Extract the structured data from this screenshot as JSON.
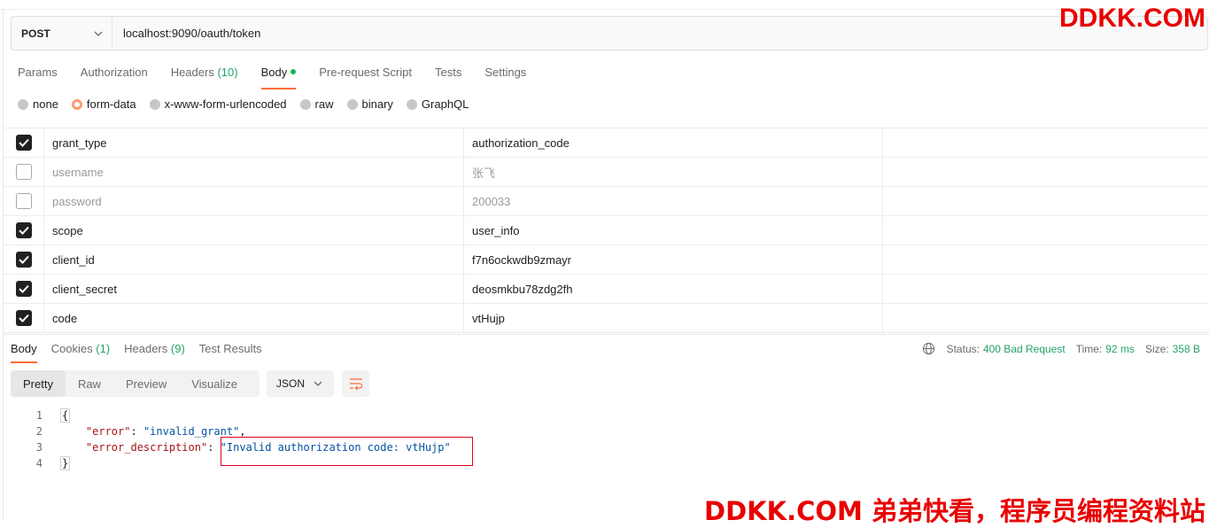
{
  "request": {
    "method": "POST",
    "url": "localhost:9090/oauth/token"
  },
  "request_tabs": {
    "params": "Params",
    "authorization": "Authorization",
    "headers": "Headers",
    "headers_count": "(10)",
    "body": "Body",
    "pre_request": "Pre-request Script",
    "tests": "Tests",
    "settings": "Settings",
    "active": "Body"
  },
  "body_types": {
    "none": "none",
    "form_data": "form-data",
    "urlencoded": "x-www-form-urlencoded",
    "raw": "raw",
    "binary": "binary",
    "graphql": "GraphQL",
    "selected": "form-data"
  },
  "params": [
    {
      "checked": true,
      "key": "grant_type",
      "value": "authorization_code"
    },
    {
      "checked": false,
      "key": "username",
      "value": "张飞"
    },
    {
      "checked": false,
      "key": "password",
      "value": "200033"
    },
    {
      "checked": true,
      "key": "scope",
      "value": "user_info"
    },
    {
      "checked": true,
      "key": "client_id",
      "value": "f7n6ockwdb9zmayr"
    },
    {
      "checked": true,
      "key": "client_secret",
      "value": "deosmkbu78zdg2fh"
    },
    {
      "checked": true,
      "key": "code",
      "value": "vtHujp"
    }
  ],
  "response_tabs": {
    "body": "Body",
    "cookies": "Cookies",
    "cookies_count": "(1)",
    "headers": "Headers",
    "headers_count": "(9)",
    "test_results": "Test Results"
  },
  "status": {
    "status_label": "Status:",
    "status_value": "400 Bad Request",
    "time_label": "Time:",
    "time_value": "92 ms",
    "size_label": "Size:",
    "size_value": "358 B"
  },
  "view": {
    "pretty": "Pretty",
    "raw": "Raw",
    "preview": "Preview",
    "visualize": "Visualize",
    "format": "JSON"
  },
  "code": {
    "line_numbers": [
      "1",
      "2",
      "3",
      "4"
    ],
    "open_brace": "{",
    "close_brace": "}",
    "key1": "\"error\"",
    "val1": "\"invalid_grant\"",
    "key2": "\"error_description\"",
    "val2": "\"Invalid authorization code: vtHujp\""
  },
  "watermark": {
    "top": "DDKK.COM",
    "bottom": "DDKK.COM 弟弟快看，程序员编程资料站"
  },
  "colors": {
    "accent": "#ff6c37",
    "success": "#26a269",
    "error_box": "#e0001a",
    "watermark": "#e80000"
  }
}
